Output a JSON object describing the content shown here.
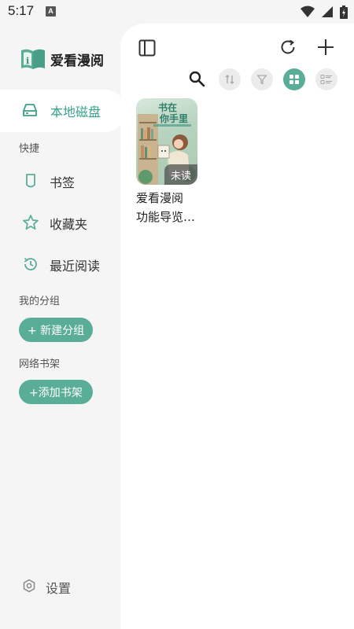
{
  "status_bar": {
    "time": "5:17",
    "notification_badge": "A",
    "icons": [
      "wifi-icon",
      "cellular-signal-icon",
      "battery-icon"
    ]
  },
  "sidebar": {
    "logo_text": "爱看漫阅",
    "local_disk_label": "本地磁盘",
    "quick_title": "快捷",
    "quick_items": [
      {
        "label": "书签",
        "icon": "bookmark-icon"
      },
      {
        "label": "收藏夹",
        "icon": "star-icon"
      },
      {
        "label": "最近阅读",
        "icon": "history-icon"
      }
    ],
    "groups_title": "我的分组",
    "new_group_button": "+ 新建分组",
    "network_title": "网络书架",
    "add_shelf_button": "+添加书架",
    "settings_label": "设置"
  },
  "toolbar": {
    "icons": [
      "sidebar-toggle-icon",
      "refresh-icon",
      "add-icon",
      "search-icon",
      "sort-icon",
      "filter-icon",
      "grid-view-icon",
      "list-view-icon"
    ],
    "active_view": "grid"
  },
  "books": [
    {
      "title": "爱看漫阅功能导览…",
      "title_line1": "爱看漫阅",
      "title_line2": "功能导览…",
      "cover_title": "书在你手里",
      "badge": "未读"
    }
  ],
  "colors": {
    "accent": "#5aad97",
    "accent_text": "#3aa18b",
    "sidebar_bg": "#f5f5f5",
    "panel_bg": "#ffffff"
  }
}
